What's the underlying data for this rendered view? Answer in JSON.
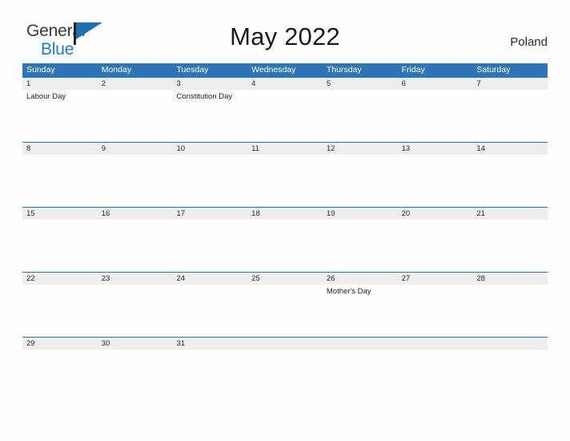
{
  "brand": {
    "name_part1": "General",
    "name_part2": "Blue",
    "flag_icon": "flag-triangle-icon",
    "color_primary": "#1f7bc1",
    "color_dark": "#3a3a3a"
  },
  "header": {
    "title": "May 2022",
    "region": "Poland"
  },
  "theme": {
    "header_blue": "#2e75b6",
    "band_gray": "#eeeeee",
    "page_bg": "#fdfdfd"
  },
  "calendar": {
    "month": "May",
    "year": "2022",
    "weekday_headers": [
      "Sunday",
      "Monday",
      "Tuesday",
      "Wednesday",
      "Thursday",
      "Friday",
      "Saturday"
    ],
    "weeks": [
      {
        "days": [
          {
            "date": "1",
            "event": "Labour Day"
          },
          {
            "date": "2",
            "event": ""
          },
          {
            "date": "3",
            "event": "Constitution Day"
          },
          {
            "date": "4",
            "event": ""
          },
          {
            "date": "5",
            "event": ""
          },
          {
            "date": "6",
            "event": ""
          },
          {
            "date": "7",
            "event": ""
          }
        ]
      },
      {
        "days": [
          {
            "date": "8",
            "event": ""
          },
          {
            "date": "9",
            "event": ""
          },
          {
            "date": "10",
            "event": ""
          },
          {
            "date": "11",
            "event": ""
          },
          {
            "date": "12",
            "event": ""
          },
          {
            "date": "13",
            "event": ""
          },
          {
            "date": "14",
            "event": ""
          }
        ]
      },
      {
        "days": [
          {
            "date": "15",
            "event": ""
          },
          {
            "date": "16",
            "event": ""
          },
          {
            "date": "17",
            "event": ""
          },
          {
            "date": "18",
            "event": ""
          },
          {
            "date": "19",
            "event": ""
          },
          {
            "date": "20",
            "event": ""
          },
          {
            "date": "21",
            "event": ""
          }
        ]
      },
      {
        "days": [
          {
            "date": "22",
            "event": ""
          },
          {
            "date": "23",
            "event": ""
          },
          {
            "date": "24",
            "event": ""
          },
          {
            "date": "25",
            "event": ""
          },
          {
            "date": "26",
            "event": "Mother's Day"
          },
          {
            "date": "27",
            "event": ""
          },
          {
            "date": "28",
            "event": ""
          }
        ]
      },
      {
        "days": [
          {
            "date": "29",
            "event": ""
          },
          {
            "date": "30",
            "event": ""
          },
          {
            "date": "31",
            "event": ""
          },
          {
            "date": "",
            "event": ""
          },
          {
            "date": "",
            "event": ""
          },
          {
            "date": "",
            "event": ""
          },
          {
            "date": "",
            "event": ""
          }
        ]
      }
    ]
  }
}
